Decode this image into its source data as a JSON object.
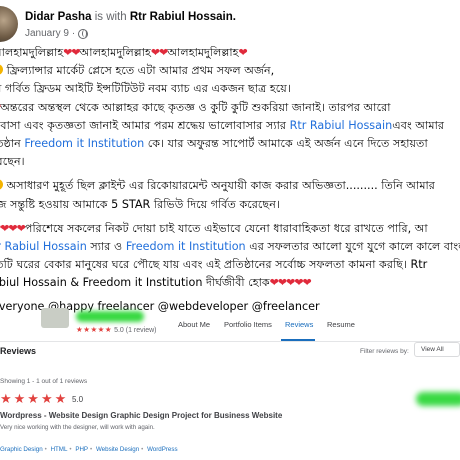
{
  "post": {
    "author": "Didar Pasha",
    "with_text": "is with",
    "tagged": "Rtr Rabiul Hossain.",
    "date": "January 9",
    "lines": {
      "l1_a": "আলহামদুলিল্লাহ",
      "l1_b": "আলহামদুলিল্লাহ",
      "l1_c": "আলহামদুলিল্লাহ",
      "l2": "ফ্রিল্যান্সার মার্কেট প্লেসে হতে এটা আমার প্রথম সফল অর্জন,",
      "l3": "মি গর্বিত ফ্রিডম আইটি ইন্সটিটিউট নবম ব্যাচ এর একজন ছাত্র হয়ে।",
      "l4": "অন্তরের অন্তস্থল থেকে আল্লাহর কাছে কৃতজ্ঞ ও কুটি কুটি শুকরিয়া জানাই। তারপর আরো",
      "l5_a": "লবাসা এবং কৃতজ্ঞতা জানাই আমার পরম শ্রদ্ধেয় ভালোবাসার স্যার",
      "l5_link": "Rtr Rabiul Hossain",
      "l5_b": "এবং আমার",
      "l6_a": "তিষ্ঠান",
      "l6_link": "Freedom it Institution",
      "l6_b": "কে। যার অফুরন্ত সাপোর্ট আমাকে এই অর্জন এনে দিতে সহায়তা",
      "l7": "রেছেন।",
      "l8": "অসাধারণ মুহূর্ত ছিল ক্লাইন্ট এর রিকোয়ারমেন্ট অনুযায়ী কাজ করার অভিজ্ঞতা......... তিনি আমার",
      "l9": "জে সন্তুষ্টি হওয়ায় আমাকে 5 STAR রিভিউ দিয়ে গর্বিত করেছেন।",
      "l10": "পরিশেষে সকলের নিকট দোয়া চাই যাতে এইভাবে যেনো ধারাবাহিকতা ধরে রাখতে পারি, আ",
      "l11_link_a": "tr Rabiul Hossain",
      "l11_mid": "স্যার ও",
      "l11_link_b": "Freedom it Institution",
      "l11_b": "এর সফলতার আলো যুগে যুগে কালে কালে বাংলার",
      "l12": "তিটি ঘরের বেকার মানুষের ঘরে পৌছে যায় এবং এই প্রতিষ্ঠানের সর্বোচ্চ সফলতা কামনা করছি। Rtr",
      "l13": "abiul Hossain & Freedom it Institution দীর্ঘজীবী হোক",
      "tags": "everyone @happy freelancer @webdeveloper @freelancer"
    }
  },
  "profile": {
    "rating_value": "5.0",
    "rating_count": "(1 review)",
    "tabs": [
      "About Me",
      "Portfolio Items",
      "Reviews",
      "Resume"
    ],
    "active_tab": "Reviews"
  },
  "reviews": {
    "title": "Reviews",
    "filter_label": "Filter reviews by:",
    "filter_value": "View All",
    "showing": "Showing 1 - 1 out of 1 reviews",
    "score": "5.0",
    "project_title": "Wordpress - Website Design Graphic Design Project for Business Website",
    "review_text": "Very nice working with the designer, will work with again.",
    "skills": [
      "Graphic Design",
      "HTML",
      "PHP",
      "Website Design",
      "WordPress"
    ]
  },
  "colors": {
    "link": "#216fdb",
    "heart": "#e02a3b",
    "star": "#e1423f",
    "tab_active": "#1a6ebd"
  },
  "icons": [
    "globe-icon",
    "heart-icon",
    "star-icon",
    "smile-emoji-icon"
  ]
}
